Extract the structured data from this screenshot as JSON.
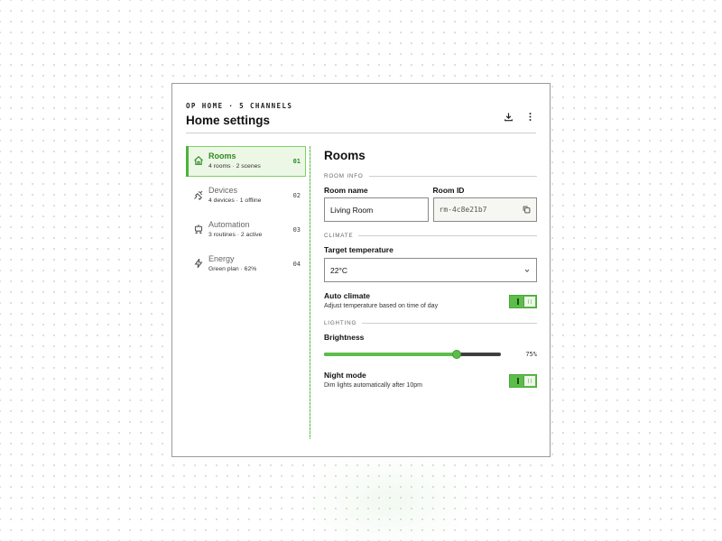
{
  "header": {
    "eyebrow": "OP HOME · 5 CHANNELS",
    "title": "Home settings",
    "actions": [
      {
        "icon": "download-icon"
      },
      {
        "icon": "more-vertical-icon"
      }
    ]
  },
  "sidebar": {
    "items": [
      {
        "label": "Rooms",
        "sub": "4 rooms · 2 scenes",
        "num": "01",
        "icon": "home-icon",
        "active": true
      },
      {
        "label": "Devices",
        "sub": "4 devices · 1 offline",
        "num": "02",
        "icon": "plug-icon",
        "active": false
      },
      {
        "label": "Automation",
        "sub": "3 routines · 2 active",
        "num": "03",
        "icon": "robot-icon",
        "active": false
      },
      {
        "label": "Energy",
        "sub": "Green plan · 62%",
        "num": "04",
        "icon": "lightning-icon",
        "active": false
      }
    ]
  },
  "main": {
    "title": "Rooms",
    "room_info": {
      "section": "ROOM INFO",
      "room_name_label": "Room name",
      "room_name_value": "Living Room",
      "room_id_label": "Room ID",
      "room_id_value": "rm-4c8e21b7"
    },
    "climate": {
      "section": "CLIMATE",
      "target_label": "Target temperature",
      "target_value": "22°C",
      "auto_label": "Auto climate",
      "auto_sub": "Adjust temperature based on time of day",
      "auto_on": true
    },
    "lighting": {
      "section": "LIGHTING",
      "brightness_label": "Brightness",
      "brightness_value": 75,
      "brightness_text": "75%",
      "night_label": "Night mode",
      "night_sub": "Dim lights automatically after 10pm",
      "night_on": true
    }
  },
  "colors": {
    "accent": "#5cbd4a",
    "accent_dark": "#2f8a22",
    "active_bg": "#ecf7e6"
  }
}
